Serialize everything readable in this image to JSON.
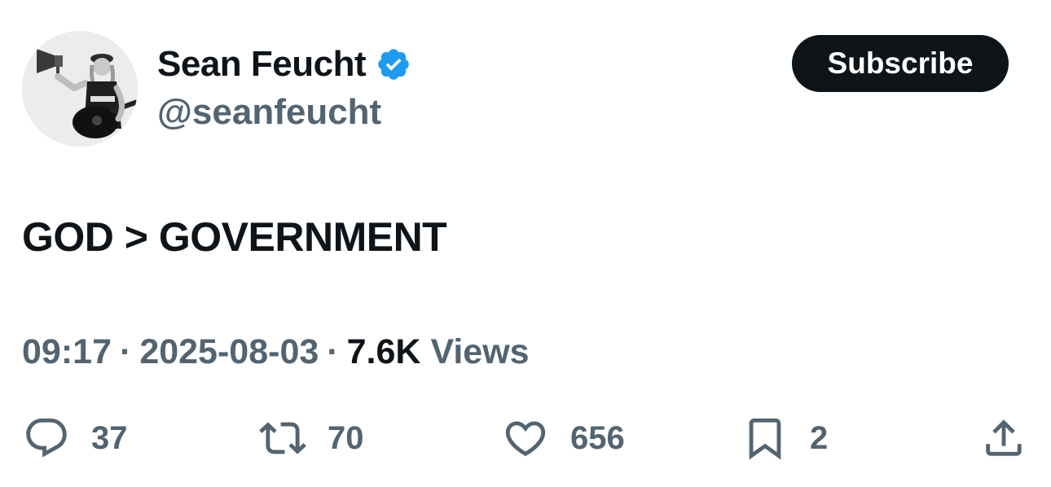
{
  "author": {
    "display_name": "Sean Feucht",
    "handle": "@seanfeucht",
    "verified_icon": "verified-badge-icon",
    "verified_color": "#1d9bf0"
  },
  "subscribe_label": "Subscribe",
  "tweet": {
    "text": "GOD > GOVERNMENT"
  },
  "meta": {
    "time": "09:17",
    "separator": "·",
    "date": "2025-08-03",
    "views_count": "7.6K",
    "views_label": "Views"
  },
  "actions": {
    "reply": {
      "icon": "reply-icon",
      "count": "37"
    },
    "retweet": {
      "icon": "retweet-icon",
      "count": "70"
    },
    "like": {
      "icon": "heart-icon",
      "count": "656"
    },
    "bookmark": {
      "icon": "bookmark-icon",
      "count": "2"
    },
    "share": {
      "icon": "share-icon"
    }
  },
  "colors": {
    "text_primary": "#0f1419",
    "text_secondary": "#536471",
    "button_bg": "#0f1419",
    "accent": "#1d9bf0"
  }
}
